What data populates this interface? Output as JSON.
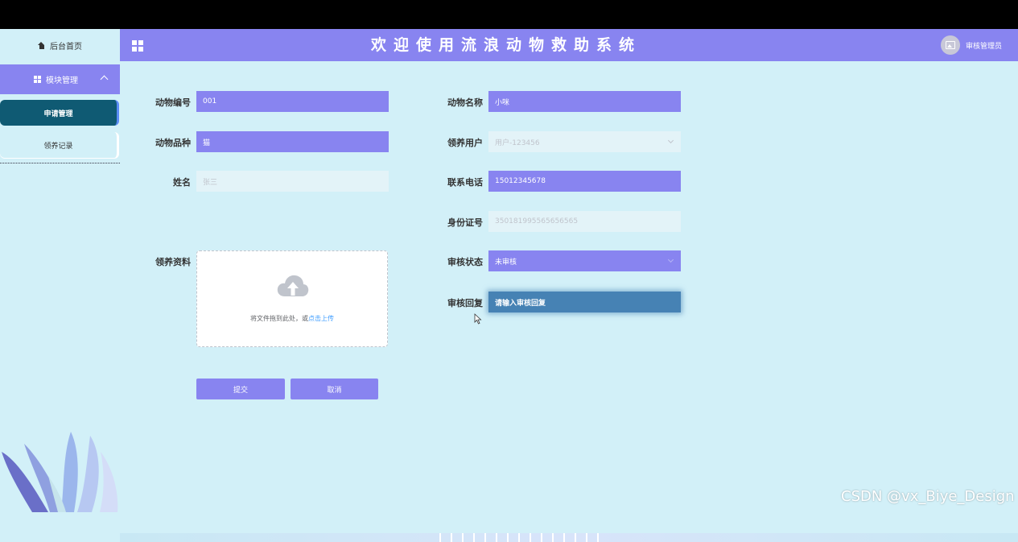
{
  "sidebar": {
    "home_label": "后台首页",
    "module_label": "模块管理",
    "items": [
      {
        "label": "申请管理"
      },
      {
        "label": "领养记录"
      }
    ]
  },
  "header": {
    "title": "欢迎使用流浪动物救助系统",
    "user": "审核管理员"
  },
  "form": {
    "animal_no": {
      "label": "动物编号",
      "value": "001"
    },
    "animal_name": {
      "label": "动物名称",
      "value": "小咪"
    },
    "animal_breed": {
      "label": "动物品种",
      "value": "猫"
    },
    "adopt_user": {
      "label": "领养用户",
      "value": "用户-123456"
    },
    "name": {
      "label": "姓名",
      "value": "张三"
    },
    "phone": {
      "label": "联系电话",
      "value": "15012345678"
    },
    "id_no": {
      "label": "身份证号",
      "value": "350181995565656565"
    },
    "materials": {
      "label": "领养资料",
      "upload_text": "将文件拖到此处，或",
      "upload_link": "点击上传"
    },
    "audit_status": {
      "label": "审核状态",
      "value": "未审核"
    },
    "audit_reply": {
      "label": "审核回复",
      "placeholder": "请输入审核回复"
    }
  },
  "buttons": {
    "submit": "提交",
    "cancel": "取消"
  },
  "watermark": "CSDN @vx_Biye_Design",
  "colors": {
    "accent": "#8884f0",
    "background": "#d2f0f8",
    "active_menu": "#0f5a73",
    "focus_field": "#4682b4"
  }
}
